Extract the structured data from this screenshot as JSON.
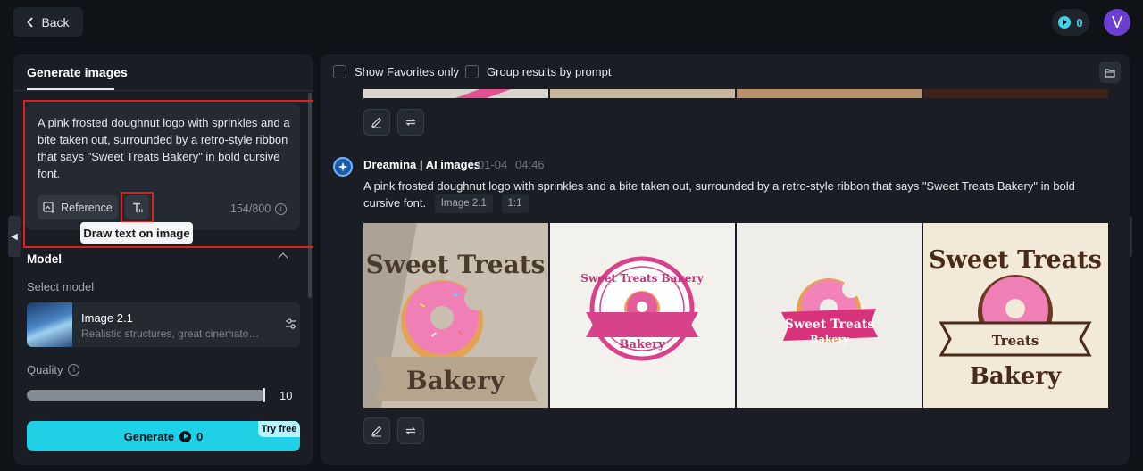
{
  "header": {
    "back_label": "Back",
    "credits": "0",
    "avatar_letter": "V"
  },
  "left_panel": {
    "tab_label": "Generate images",
    "prompt": "A pink frosted doughnut logo with sprinkles and a bite taken out, surrounded by a retro-style ribbon that says \"Sweet Treats Bakery\" in bold cursive font.",
    "reference_label": "Reference",
    "char_count": "154/800",
    "tooltip": "Draw text on image",
    "model_section_title": "Model",
    "select_model_label": "Select model",
    "model": {
      "name": "Image 2.1",
      "description": "Realistic structures, great cinematography"
    },
    "quality_label": "Quality",
    "quality_value": "10",
    "quality_fraction": 1.0,
    "generate_label": "Generate",
    "generate_cost": "0",
    "try_free_label": "Try free"
  },
  "right_panel": {
    "filters": {
      "favorites_label": "Show Favorites only",
      "group_label": "Group results by prompt"
    },
    "generation": {
      "author": "Dreamina | AI images",
      "date": "01-04",
      "time": "04:46",
      "prompt": "A pink frosted doughnut logo with sprinkles and a bite taken out, surrounded by a retro-style ribbon that says \"Sweet Treats Bakery\" in bold cursive font.",
      "model_tag": "Image 2.1",
      "ratio_tag": "1:1",
      "images": [
        {
          "line1": "Sweet Treats",
          "line2": "Bakery"
        },
        {
          "line1": "Sweet Treats Bakery",
          "line2": "Bakery"
        },
        {
          "line1": "Sweet Treats",
          "line2": "Bakery"
        },
        {
          "line1": "Sweet Treats",
          "line2": "Treats",
          "line3": "Bakery"
        }
      ]
    }
  },
  "colors": {
    "accent": "#1fd0e6",
    "highlight": "#e02020",
    "panel": "#1a1e24",
    "background": "#0f1216"
  },
  "icons": [
    "chevron-left-icon",
    "credit-coin-icon",
    "reference-image-icon",
    "text-tool-icon",
    "info-icon",
    "chevron-up-icon",
    "settings-sliders-icon",
    "folder-icon",
    "edit-pencil-icon",
    "regenerate-icon",
    "dreamina-logo-icon",
    "arrow-left-icon",
    "arrow-right-icon"
  ]
}
